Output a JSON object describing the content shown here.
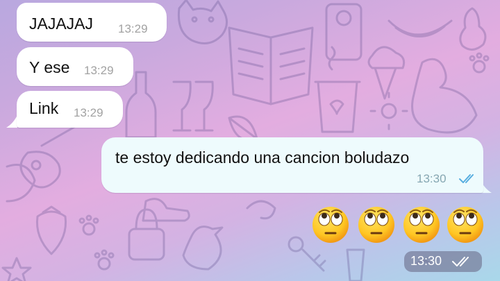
{
  "colors": {
    "incoming_bubble": "#ffffff",
    "outgoing_bubble": "#eefbfd",
    "read_ticks": "#58aee0",
    "time_incoming": "#a2a2a2",
    "time_pill": "#6e708c"
  },
  "messages": [
    {
      "direction": "incoming",
      "text": "JAJAJAJ",
      "time": "13:29"
    },
    {
      "direction": "incoming",
      "text": "Y ese",
      "time": "13:29"
    },
    {
      "direction": "incoming",
      "text": "Link",
      "time": "13:29"
    },
    {
      "direction": "outgoing",
      "text": "te estoy dedicando una cancion boludazo",
      "time": "13:30",
      "status_icon": "double-check-read-icon"
    }
  ],
  "emoji_message": {
    "emojis": [
      "face-with-rolling-eyes-icon",
      "face-with-rolling-eyes-icon",
      "face-with-rolling-eyes-icon",
      "face-with-rolling-eyes-icon"
    ],
    "time": "13:30",
    "status_icon": "double-check-read-icon"
  }
}
